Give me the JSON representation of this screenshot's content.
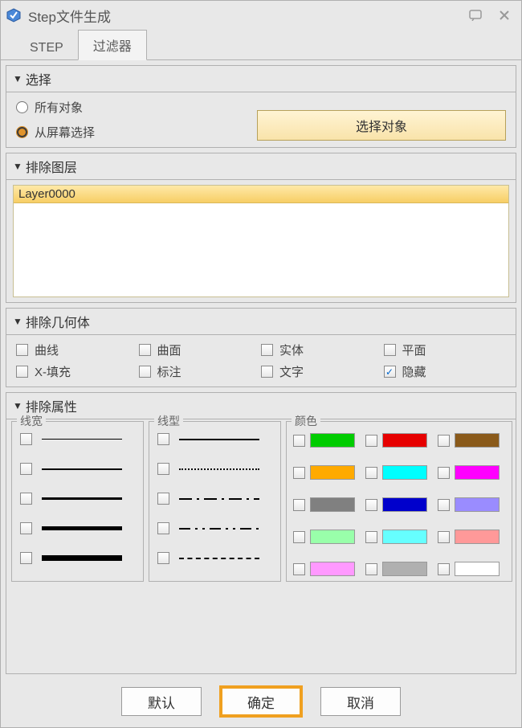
{
  "window": {
    "title": "Step文件生成"
  },
  "tabs": {
    "step": "STEP",
    "filter": "过滤器"
  },
  "sections": {
    "select": "选择",
    "exclude_layer": "排除图层",
    "exclude_geom": "排除几何体",
    "exclude_attr": "排除属性"
  },
  "select": {
    "all_objects": "所有对象",
    "from_screen": "从屏幕选择",
    "button": "选择对象"
  },
  "layers": {
    "item0": "Layer0000"
  },
  "geom": {
    "curve": "曲线",
    "surface": "曲面",
    "solid": "实体",
    "plane": "平面",
    "xfill": "X-填充",
    "annot": "标注",
    "text": "文字",
    "hidden": "隐藏"
  },
  "attr_groups": {
    "width": "线宽",
    "type": "线型",
    "color": "颜色"
  },
  "colors": {
    "c0": "#00cc00",
    "c1": "#e60000",
    "c2": "#8a5a1a",
    "c3": "#ffaa00",
    "c4": "#00ffff",
    "c5": "#ff00ff",
    "c6": "#808080",
    "c7": "#0000cc",
    "c8": "#9a8cff",
    "c9": "#99ffaa",
    "c10": "#66ffff",
    "c11": "#ff9999",
    "c12": "#ff99ff",
    "c13": "#b0b0b0",
    "c14": "#ffffff"
  },
  "buttons": {
    "default": "默认",
    "ok": "确定",
    "cancel": "取消"
  }
}
